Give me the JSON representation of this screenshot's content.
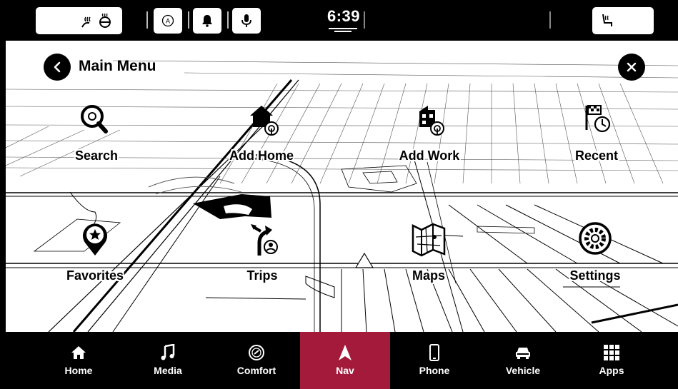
{
  "status_bar": {
    "time": "6:39",
    "left_pill_icons": [
      "heated-steering-wheel-icon",
      "heated-seat-icon"
    ],
    "quick_icons": [
      "auto-hold-icon",
      "notifications-bell-icon",
      "voice-microphone-icon"
    ],
    "right_pill_icons": [
      "passenger-heated-seat-icon"
    ]
  },
  "header": {
    "title": "Main Menu",
    "back_icon": "chevron-left-icon",
    "close_icon": "close-icon"
  },
  "menu": {
    "items": [
      {
        "label": "Search",
        "icon": "search-icon"
      },
      {
        "label": "Add Home",
        "icon": "home-add-icon"
      },
      {
        "label": "Add Work",
        "icon": "work-add-icon"
      },
      {
        "label": "Recent",
        "icon": "recent-history-icon"
      },
      {
        "label": "Favorites",
        "icon": "favorites-pin-icon"
      },
      {
        "label": "Trips",
        "icon": "trips-icon"
      },
      {
        "label": "Maps",
        "icon": "maps-icon"
      },
      {
        "label": "Settings",
        "icon": "settings-gear-icon"
      }
    ]
  },
  "nav": {
    "active": "Nav",
    "active_color": "#a31a3a",
    "items": [
      {
        "label": "Home",
        "icon": "home-icon"
      },
      {
        "label": "Media",
        "icon": "music-note-icon"
      },
      {
        "label": "Comfort",
        "icon": "comfort-icon"
      },
      {
        "label": "Nav",
        "icon": "navigation-arrow-icon"
      },
      {
        "label": "Phone",
        "icon": "phone-icon"
      },
      {
        "label": "Vehicle",
        "icon": "car-icon"
      },
      {
        "label": "Apps",
        "icon": "apps-grid-icon"
      }
    ]
  }
}
